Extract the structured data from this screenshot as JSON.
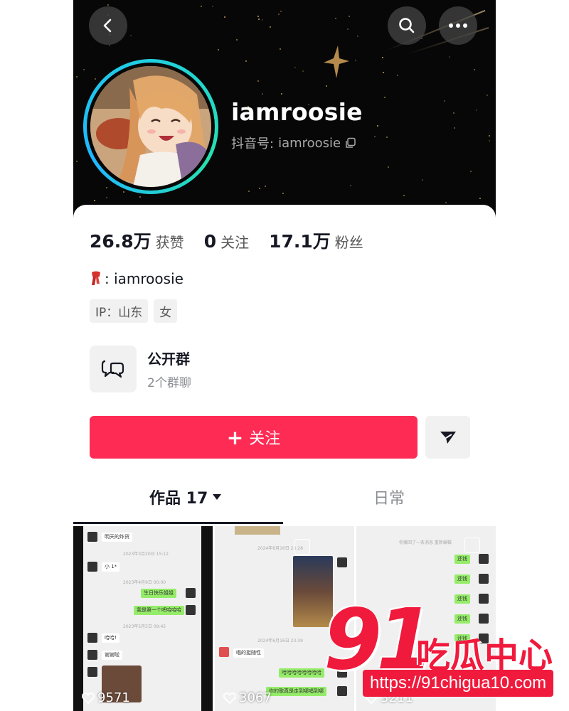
{
  "profile": {
    "username": "iamroosie",
    "douyin_id_label": "抖音号: ",
    "douyin_id": "iamroosie",
    "bio_name": ": iamroosie",
    "tags": [
      "IP：山东",
      "女"
    ]
  },
  "stats": [
    {
      "value": "26.8万",
      "label": "获赞"
    },
    {
      "value": "0",
      "label": "关注"
    },
    {
      "value": "17.1万",
      "label": "粉丝"
    }
  ],
  "group": {
    "title": "公开群",
    "subtitle": "2个群聊"
  },
  "actions": {
    "follow_label": "关注",
    "follow_prefix": "+"
  },
  "tabs": [
    {
      "label": "作品 17",
      "active": true
    },
    {
      "label": "日常",
      "active": false
    }
  ],
  "videos": [
    {
      "likes": "9571",
      "messages_left": [
        "明天的炸货",
        "小 1*",
        "哈哈!",
        "谢谢啦"
      ],
      "messages_right": [
        "生日快乐姐姐",
        "我是第一个吧哈哈哈"
      ],
      "timestamps": [
        "2023年3月20日 15:12",
        "2023年4月9日 00:00",
        "2023年5月5日 09:45"
      ]
    },
    {
      "likes": "3067",
      "messages_left": [
        "唱的挺随性"
      ],
      "messages_right": [
        "哈哈哈哈哈哈哈哈",
        "你的歌真是走到哪唱到哪"
      ],
      "timestamps": [
        "2024年6月16日 23:28",
        "2024年6月16日 23:39"
      ]
    },
    {
      "likes": "3211",
      "messages_left": [],
      "messages_right": [
        "还钱",
        "还钱",
        "还钱",
        "还钱",
        "还钱"
      ],
      "timestamps": [
        "你撤回了一条消息 重新编辑"
      ]
    }
  ],
  "watermark": {
    "brand_number": "91",
    "brand_text": "吃瓜中心",
    "url": "https://91chigua10.com"
  },
  "colors": {
    "accent": "#fe2c55",
    "header_bg": "#070707",
    "avatar_ring": "#20d0e0",
    "watermark": "#f01a3c"
  }
}
